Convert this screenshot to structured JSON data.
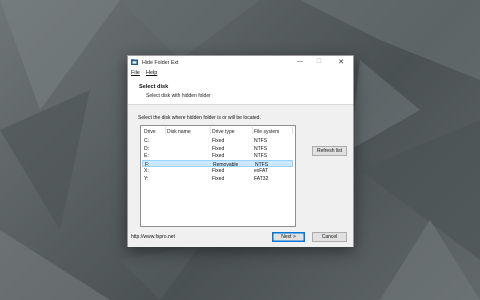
{
  "window": {
    "title": "Hide Folder Ext",
    "controls": {
      "minimize": "—",
      "maximize": "☐",
      "close": "✕"
    }
  },
  "menu": {
    "file": "File",
    "help": "Help"
  },
  "header": {
    "title": "Select disk",
    "subtitle": "Select disk with hidden folder"
  },
  "content": {
    "instruction": "Select the disk where hidden folder is or will be located.",
    "columns": [
      "Drive",
      "Disk name",
      "Drive type",
      "File system"
    ],
    "drives": [
      {
        "drive": "C:",
        "name": "",
        "type": "Fixed",
        "fs": "NTFS"
      },
      {
        "drive": "D:",
        "name": "",
        "type": "Fixed",
        "fs": "NTFS"
      },
      {
        "drive": "E:",
        "name": "",
        "type": "Fixed",
        "fs": "NTFS"
      },
      {
        "drive": "F:",
        "name": "",
        "type": "Removable",
        "fs": "NTFS"
      },
      {
        "drive": "X:",
        "name": "",
        "type": "Fixed",
        "fs": "exFAT"
      },
      {
        "drive": "Y:",
        "name": "",
        "type": "Fixed",
        "fs": "FAT32"
      }
    ],
    "selected_drive": "F:"
  },
  "buttons": {
    "refresh": "Refresh list",
    "next": "Next >",
    "cancel": "Cancel"
  },
  "footer": {
    "link": "http://www.fspro.net"
  },
  "icons": {
    "app": "folder-app-icon"
  }
}
